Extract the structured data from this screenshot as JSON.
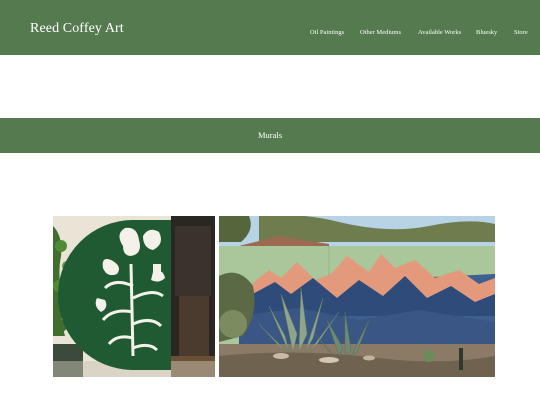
{
  "header": {
    "site_title": "Reed Coffey Art",
    "nav": [
      {
        "label": "Oil Paintings"
      },
      {
        "label": "Other Mediums"
      },
      {
        "label": "Available Works"
      },
      {
        "label": "Bluesky"
      },
      {
        "label": "Store"
      }
    ]
  },
  "section": {
    "title": "Murals"
  },
  "gallery": [
    {
      "subject": "botanical-circle-mural"
    },
    {
      "subject": "mountain-wall-mural"
    }
  ],
  "colors": {
    "brand_green": "#557a4f",
    "background": "#ffffff",
    "text_on_brand": "#ffffff"
  }
}
